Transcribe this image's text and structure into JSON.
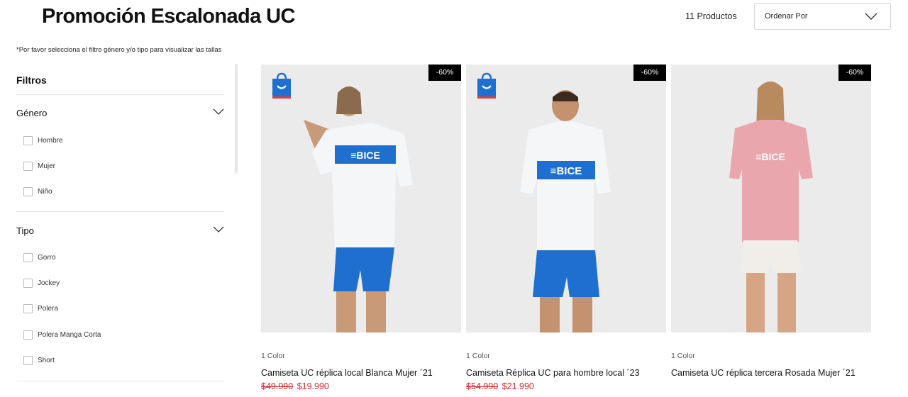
{
  "header": {
    "title": "Promoción Escalonada UC",
    "product_count": "11 Productos",
    "sort_label": "Ordenar Por"
  },
  "notice": "*Por favor selecciona el filtro género y/o tipo para visualizar las tallas",
  "filters": {
    "title": "Filtros",
    "groups": [
      {
        "title": "Género",
        "options": [
          "Hombre",
          "Mujer",
          "Niño"
        ]
      },
      {
        "title": "Tipo",
        "options": [
          "Gorro",
          "Jockey",
          "Polera",
          "Polera Manga Corta",
          "Short"
        ]
      }
    ]
  },
  "products": [
    {
      "badge": "-60%",
      "colors": "1 Color",
      "name": "Camiseta UC réplica local Blanca Mujer ´21",
      "old_price": "$49.990",
      "price": "$19.990",
      "jersey_color": "#f4f6f8",
      "show_bag": true
    },
    {
      "badge": "-60%",
      "colors": "1 Color",
      "name": "Camiseta Réplica UC para hombre local ´23",
      "old_price": "$54.990",
      "price": "$21.990",
      "jersey_color": "#f4f6f8",
      "show_bag": true
    },
    {
      "badge": "-60%",
      "colors": "1 Color",
      "name": "Camiseta UC réplica tercera Rosada Mujer ´21",
      "old_price": "",
      "price": "",
      "jersey_color": "#e9a7ad",
      "show_bag": false
    }
  ],
  "colors": {
    "accent_blue": "#1f6fd1",
    "sale_red": "#d42a2a",
    "badge_bg": "#000000"
  },
  "icons": {
    "sort": "chevron-down-icon",
    "group": "chevron-down-icon",
    "bag": "shopping-bag-icon"
  }
}
